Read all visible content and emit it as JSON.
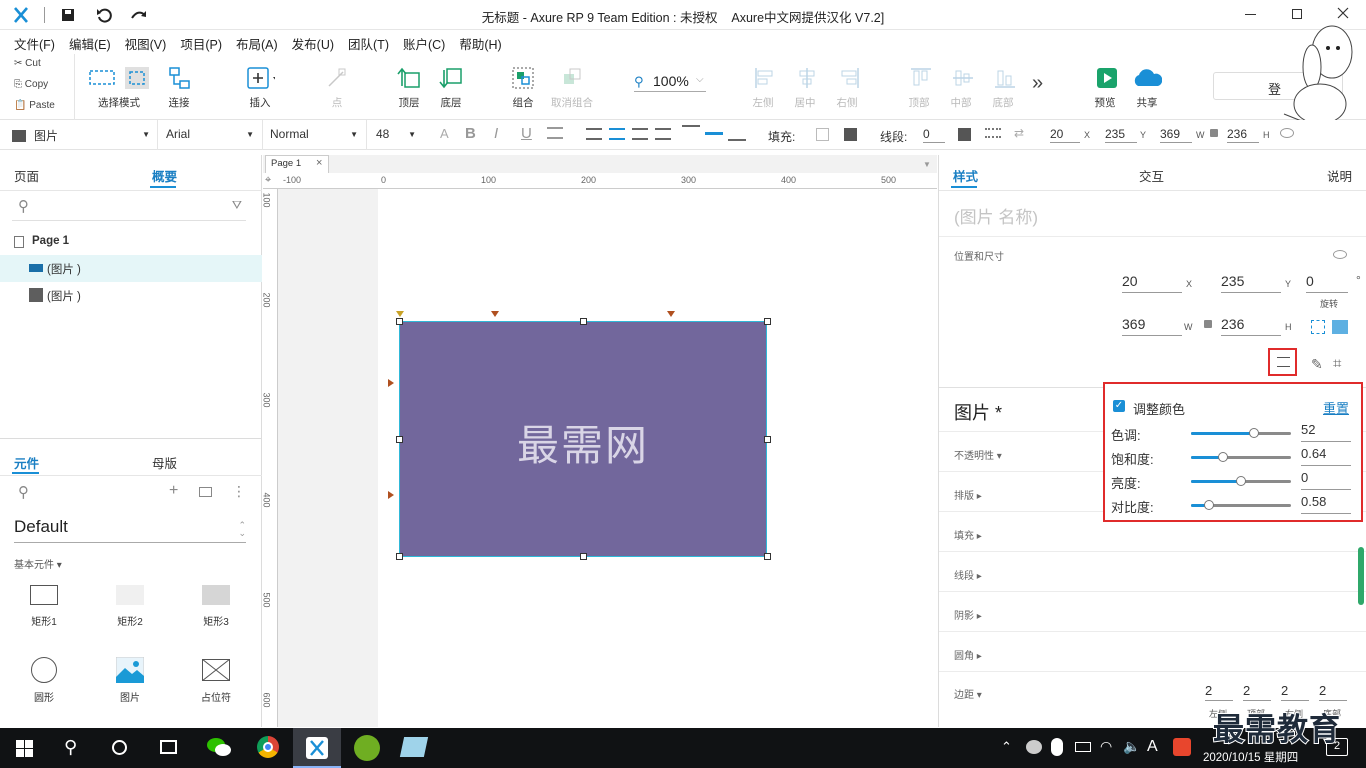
{
  "window": {
    "title": "无标题 - Axure RP 9 Team Edition : 未授权    Axure中文网提供汉化 V7.2]",
    "controls": [
      "minimize",
      "restore",
      "close"
    ]
  },
  "menu": [
    "文件(F)",
    "编辑(E)",
    "视图(V)",
    "项目(P)",
    "布局(A)",
    "发布(U)",
    "团队(T)",
    "账户(C)",
    "帮助(H)"
  ],
  "clipboard": {
    "cut": "Cut",
    "copy": "Copy",
    "paste": "Paste"
  },
  "toolbar": {
    "select_mode": "选择模式",
    "connect": "连接",
    "insert": "插入",
    "point": "点",
    "top_layer": "顶层",
    "bottom_layer": "底层",
    "group": "组合",
    "ungroup": "取消组合",
    "zoom": "100%",
    "align_left": "左侧",
    "align_center": "居中",
    "align_right": "右侧",
    "align_top": "顶部",
    "align_middle": "中部",
    "align_bottom": "底部",
    "more": "»",
    "preview": "预览",
    "share": "共享",
    "login": "登"
  },
  "format": {
    "widget_type": "图片",
    "font": "Arial",
    "style": "Normal",
    "size": "48",
    "fill_label": "填充:",
    "stroke_label": "线段:",
    "stroke_value": "0",
    "x": "20",
    "y": "235",
    "w": "369",
    "h": "236",
    "x_label": "X",
    "y_label": "Y",
    "w_label": "W",
    "h_label": "H"
  },
  "left": {
    "tabs": {
      "pages": "页面",
      "outline": "概要"
    },
    "outline": [
      {
        "label": "Page 1"
      },
      {
        "label": "(图片 )"
      },
      {
        "label": "(图片 )"
      }
    ],
    "lib_tabs": {
      "widgets": "元件",
      "masters": "母版"
    },
    "library": "Default",
    "basic": "基本元件 ▾",
    "widgets": [
      "矩形1",
      "矩形2",
      "矩形3",
      "圆形",
      "图片",
      "占位符"
    ]
  },
  "canvas": {
    "tab": "Page 1",
    "ruler_h": [
      "-100",
      "0",
      "100",
      "200",
      "300",
      "400",
      "500"
    ],
    "ruler_v": [
      "100",
      "200",
      "300",
      "400",
      "500",
      "600"
    ],
    "image_text": "最需网",
    "image_color": "#72679c"
  },
  "right": {
    "tabs": {
      "style": "样式",
      "interaction": "交互",
      "notes": "说明"
    },
    "name_placeholder": "(图片 名称)",
    "pos_size": "位置和尺寸",
    "x": "20",
    "y": "235",
    "rotation": "0",
    "rotation_label": "旋转",
    "w": "369",
    "h": "236",
    "x_label": "X",
    "y_label": "Y",
    "w_label": "W",
    "h_label": "H",
    "deg": "°",
    "image_heading": "图片 *",
    "sections": [
      "不透明性 ▾",
      "排版 ▸",
      "填充 ▸",
      "线段 ▸",
      "阴影 ▸",
      "圆角 ▸",
      "边距 ▾"
    ],
    "margins": [
      {
        "v": "2",
        "l": "左侧"
      },
      {
        "v": "2",
        "l": "顶部"
      },
      {
        "v": "2",
        "l": "右侧"
      },
      {
        "v": "2",
        "l": "底部"
      }
    ]
  },
  "adjust": {
    "checkbox_label": "调整颜色",
    "reset": "重置",
    "rows": [
      {
        "label": "色调:",
        "value": "52",
        "pct": 0.63
      },
      {
        "label": "饱和度:",
        "value": "0.64",
        "pct": 0.32
      },
      {
        "label": "亮度:",
        "value": "0",
        "pct": 0.5
      },
      {
        "label": "对比度:",
        "value": "0.58",
        "pct": 0.18
      }
    ]
  },
  "watermark": "最需教育",
  "taskbar": {
    "time": "9:",
    "date": "2020/10/15 星期四",
    "notif": "2",
    "ime": "A"
  }
}
